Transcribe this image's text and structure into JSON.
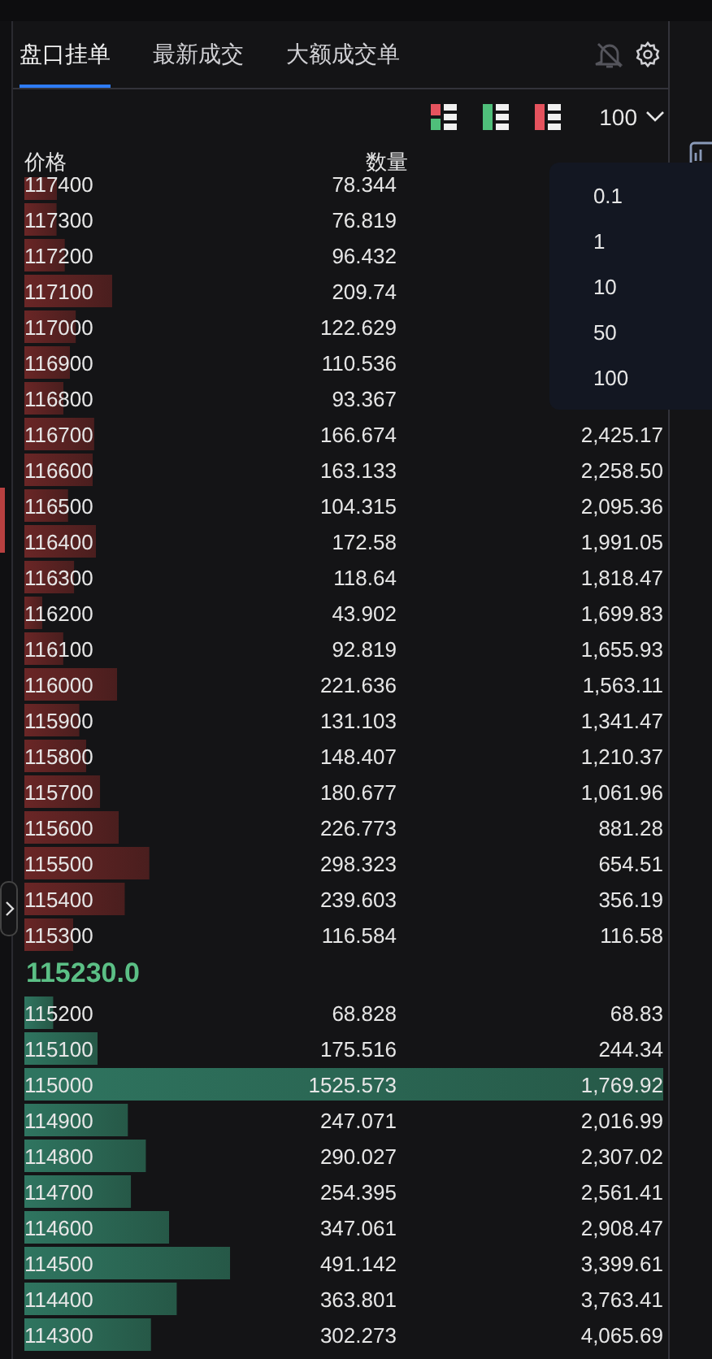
{
  "tabs": [
    {
      "label": "盘口挂单",
      "selected": true
    },
    {
      "label": "最新成交",
      "selected": false
    },
    {
      "label": "大额成交单",
      "selected": false
    }
  ],
  "alerts": {
    "on": false
  },
  "precision": {
    "value": "100",
    "expanded": true,
    "options": [
      "0.1",
      "1",
      "10",
      "50",
      "100"
    ]
  },
  "columns": [
    "价格",
    "数量"
  ],
  "asks": [
    {
      "price": "117400",
      "quantity": "78.344"
    },
    {
      "price": "117300",
      "quantity": "76.819"
    },
    {
      "price": "117200",
      "quantity": "96.432"
    },
    {
      "price": "117100",
      "quantity": "209.74"
    },
    {
      "price": "117000",
      "quantity": "122.629"
    },
    {
      "price": "116900",
      "quantity": "110.536"
    },
    {
      "price": "116800",
      "quantity": "93.367"
    },
    {
      "price": "116700",
      "quantity": "166.674",
      "total": "2,425.17"
    },
    {
      "price": "116600",
      "quantity": "163.133",
      "total": "2,258.50"
    },
    {
      "price": "116500",
      "quantity": "104.315",
      "total": "2,095.36"
    },
    {
      "price": "116400",
      "quantity": "172.58",
      "total": "1,991.05"
    },
    {
      "price": "116300",
      "quantity": "118.64",
      "total": "1,818.47"
    },
    {
      "price": "116200",
      "quantity": "43.902",
      "total": "1,699.83"
    },
    {
      "price": "116100",
      "quantity": "92.819",
      "total": "1,655.93"
    },
    {
      "price": "116000",
      "quantity": "221.636",
      "total": "1,563.11"
    },
    {
      "price": "115900",
      "quantity": "131.103",
      "total": "1,341.47"
    },
    {
      "price": "115800",
      "quantity": "148.407",
      "total": "1,210.37"
    },
    {
      "price": "115700",
      "quantity": "180.677",
      "total": "1,061.96"
    },
    {
      "price": "115600",
      "quantity": "226.773",
      "total": "881.28"
    },
    {
      "price": "115500",
      "quantity": "298.323",
      "total": "654.51"
    },
    {
      "price": "115400",
      "quantity": "239.603",
      "total": "356.19"
    },
    {
      "price": "115300",
      "quantity": "116.584",
      "total": "116.58"
    }
  ],
  "last_price": "115230.0",
  "bids": [
    {
      "price": "115200",
      "quantity": "68.828",
      "total": "68.83"
    },
    {
      "price": "115100",
      "quantity": "175.516",
      "total": "244.34"
    },
    {
      "price": "115000",
      "quantity": "1525.573",
      "total": "1,769.92"
    },
    {
      "price": "114900",
      "quantity": "247.071",
      "total": "2,016.99"
    },
    {
      "price": "114800",
      "quantity": "290.027",
      "total": "2,307.02"
    },
    {
      "price": "114700",
      "quantity": "254.395",
      "total": "2,561.41"
    },
    {
      "price": "114600",
      "quantity": "347.061",
      "total": "2,908.47"
    },
    {
      "price": "114500",
      "quantity": "491.142",
      "total": "3,399.61"
    },
    {
      "price": "114400",
      "quantity": "363.801",
      "total": "3,763.41"
    },
    {
      "price": "114300",
      "quantity": "302.273",
      "total": "4,065.69"
    }
  ]
}
